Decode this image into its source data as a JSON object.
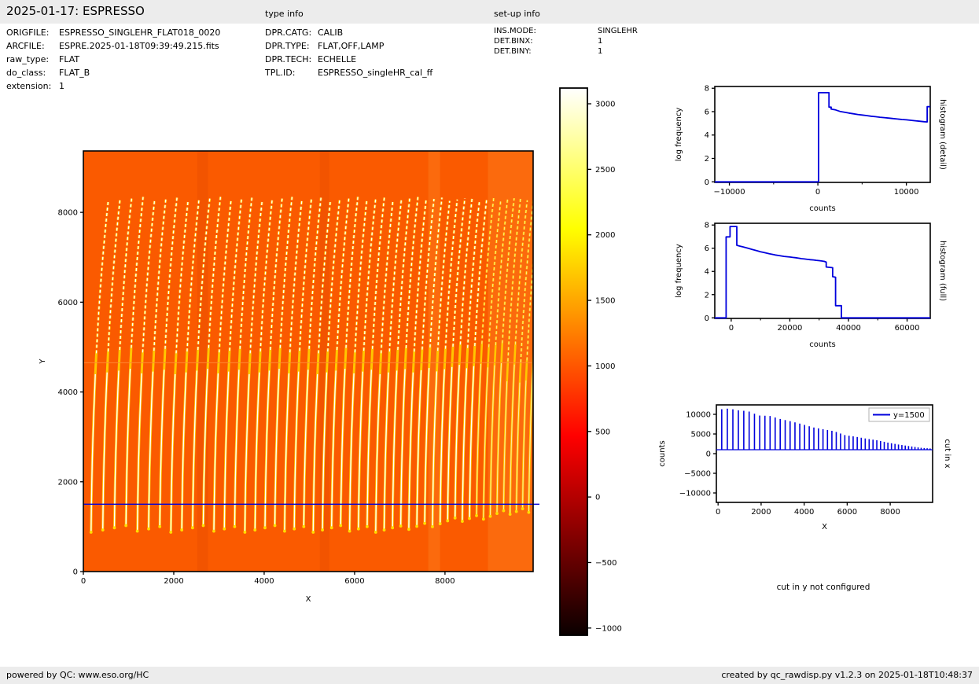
{
  "header": {
    "title": "2025-01-17: ESPRESSO",
    "type_info_label": "type info",
    "setup_info_label": "set-up info"
  },
  "file_info": {
    "rows": [
      {
        "label": "ORIGFILE:",
        "value": "ESPRESSO_SINGLEHR_FLAT018_0020"
      },
      {
        "label": "ARCFILE:",
        "value": "ESPRE.2025-01-18T09:39:49.215.fits"
      },
      {
        "label": "raw_type:",
        "value": "FLAT"
      },
      {
        "label": "do_class:",
        "value": "FLAT_B"
      },
      {
        "label": "extension:",
        "value": "1"
      }
    ]
  },
  "type_info": {
    "rows": [
      {
        "label": "DPR.CATG:",
        "value": "CALIB"
      },
      {
        "label": "DPR.TYPE:",
        "value": "FLAT,OFF,LAMP"
      },
      {
        "label": "DPR.TECH:",
        "value": "ECHELLE"
      },
      {
        "label": "TPL.ID:",
        "value": "ESPRESSO_singleHR_cal_ff"
      }
    ]
  },
  "setup_info": {
    "rows": [
      {
        "label": "INS.MODE:",
        "value": "SINGLEHR"
      },
      {
        "label": "DET.BINX:",
        "value": "1"
      },
      {
        "label": "DET.BINY:",
        "value": "1"
      }
    ]
  },
  "footer": {
    "left": "powered by QC: www.eso.org/HC",
    "right": "created by qc_rawdisp.py v1.2.3 on 2025-01-18T10:48:37"
  },
  "cut_y_note": "cut in y not configured",
  "colors": {
    "line_blue": "#0000dd",
    "image_background": "#fa5a00",
    "stripe_white": "#ffffff",
    "stripe_yellow": "#ffcc00",
    "panel_gray": "#ececec"
  },
  "chart_data": [
    {
      "id": "raw_image",
      "type": "heatmap",
      "xlabel": "X",
      "ylabel": "Y",
      "xlim": [
        0,
        9950
      ],
      "ylim": [
        0,
        9368
      ],
      "x_ticks": [
        0,
        2000,
        4000,
        6000,
        8000
      ],
      "y_ticks": [
        0,
        2000,
        4000,
        6000,
        8000
      ],
      "background_counts": 1000,
      "cut_line_y": 1500,
      "detector_gap_y": 4650,
      "orders": {
        "count": 50,
        "x_start": 170,
        "spacing_start": 260,
        "spacing_step": -2.6,
        "top_shift": 380,
        "y_bottom": 950,
        "y_top": 8300
      },
      "bands": [
        {
          "x0": 2520,
          "x1": 2760,
          "shade": "dark"
        },
        {
          "x0": 5230,
          "x1": 5440,
          "shade": "dark"
        },
        {
          "x0": 7630,
          "x1": 7890,
          "shade": "light"
        },
        {
          "x0": 8950,
          "x1": 9950,
          "shade": "light"
        }
      ]
    },
    {
      "id": "colorbar",
      "type": "colorbar",
      "vmin": -1055,
      "vmax": 3120,
      "ticks": [
        3000,
        2500,
        2000,
        1500,
        1000,
        500,
        0,
        -500,
        -1000
      ],
      "gradient": [
        {
          "v": 3120,
          "color": "#ffffff"
        },
        {
          "v": 2045,
          "color": "#ffff00"
        },
        {
          "v": 465,
          "color": "#ff0000"
        },
        {
          "v": -1055,
          "color": "#0a0000"
        }
      ]
    },
    {
      "id": "hist_detail",
      "type": "line",
      "side_label": "histogram (detail)",
      "xlabel": "counts",
      "ylabel": "log frequency",
      "xlim": [
        -11650,
        12700
      ],
      "ylim": [
        -0.05,
        8.15
      ],
      "x_ticks": [
        -10000,
        0,
        10000
      ],
      "x_minor_ticks": [
        -5000,
        5000
      ],
      "y_ticks": [
        0,
        2,
        4,
        6,
        8
      ],
      "points": [
        [
          -11650,
          0
        ],
        [
          80,
          0
        ],
        [
          80,
          7.62
        ],
        [
          1250,
          7.62
        ],
        [
          1250,
          6.38
        ],
        [
          1500,
          6.38
        ],
        [
          1500,
          6.22
        ],
        [
          2000,
          6.15
        ],
        [
          2500,
          6.02
        ],
        [
          3000,
          5.95
        ],
        [
          3500,
          5.88
        ],
        [
          4000,
          5.82
        ],
        [
          4500,
          5.76
        ],
        [
          5000,
          5.71
        ],
        [
          5500,
          5.66
        ],
        [
          6000,
          5.61
        ],
        [
          6500,
          5.57
        ],
        [
          7000,
          5.52
        ],
        [
          7500,
          5.49
        ],
        [
          8000,
          5.45
        ],
        [
          8500,
          5.41
        ],
        [
          9000,
          5.37
        ],
        [
          9500,
          5.33
        ],
        [
          10000,
          5.3
        ],
        [
          10500,
          5.26
        ],
        [
          11000,
          5.22
        ],
        [
          11500,
          5.18
        ],
        [
          12000,
          5.14
        ],
        [
          12350,
          5.12
        ],
        [
          12350,
          6.42
        ],
        [
          12700,
          6.42
        ]
      ]
    },
    {
      "id": "hist_full",
      "type": "line",
      "side_label": "histogram (full)",
      "xlabel": "counts",
      "ylabel": "log frequency",
      "xlim": [
        -5600,
        67900
      ],
      "ylim": [
        -0.05,
        8.15
      ],
      "x_ticks": [
        0,
        20000,
        40000,
        60000
      ],
      "x_minor_ticks": [
        10000,
        30000,
        50000
      ],
      "y_ticks": [
        0,
        2,
        4,
        6,
        8
      ],
      "points": [
        [
          -5600,
          0
        ],
        [
          -1750,
          0
        ],
        [
          -1750,
          6.98
        ],
        [
          -400,
          6.98
        ],
        [
          -400,
          7.87
        ],
        [
          1900,
          7.87
        ],
        [
          1900,
          6.25
        ],
        [
          2400,
          6.22
        ],
        [
          3000,
          6.18
        ],
        [
          4000,
          6.12
        ],
        [
          5000,
          6.05
        ],
        [
          6000,
          5.98
        ],
        [
          7000,
          5.91
        ],
        [
          8000,
          5.84
        ],
        [
          9000,
          5.77
        ],
        [
          10000,
          5.7
        ],
        [
          11000,
          5.64
        ],
        [
          12000,
          5.58
        ],
        [
          13000,
          5.52
        ],
        [
          14000,
          5.47
        ],
        [
          15000,
          5.42
        ],
        [
          16000,
          5.38
        ],
        [
          17000,
          5.34
        ],
        [
          18000,
          5.3
        ],
        [
          19000,
          5.27
        ],
        [
          20000,
          5.24
        ],
        [
          21000,
          5.21
        ],
        [
          22000,
          5.18
        ],
        [
          23000,
          5.14
        ],
        [
          24000,
          5.1
        ],
        [
          25000,
          5.07
        ],
        [
          26000,
          5.04
        ],
        [
          27000,
          5.01
        ],
        [
          28000,
          4.99
        ],
        [
          29000,
          4.96
        ],
        [
          30000,
          4.93
        ],
        [
          31000,
          4.9
        ],
        [
          31800,
          4.86
        ],
        [
          32400,
          4.8
        ],
        [
          32400,
          4.38
        ],
        [
          34600,
          4.32
        ],
        [
          34600,
          3.55
        ],
        [
          35600,
          3.5
        ],
        [
          35600,
          1.05
        ],
        [
          37600,
          1.05
        ],
        [
          37600,
          0
        ],
        [
          67900,
          0
        ]
      ]
    },
    {
      "id": "cut_x",
      "type": "line",
      "side_label": "cut in x",
      "legend_label": "y=1500",
      "xlabel": "X",
      "ylabel": "counts",
      "xlim": [
        -80,
        9970
      ],
      "ylim": [
        -12400,
        12400
      ],
      "x_ticks": [
        0,
        2000,
        4000,
        6000,
        8000
      ],
      "y_ticks": [
        10000,
        5000,
        0,
        -5000,
        -10000
      ],
      "baseline_counts": 1000,
      "spike_height_envelope": [
        [
          170,
          11300
        ],
        [
          500,
          11480
        ],
        [
          900,
          11050
        ],
        [
          1400,
          10800
        ],
        [
          1900,
          9700
        ],
        [
          2400,
          9600
        ],
        [
          2900,
          8800
        ],
        [
          3400,
          8200
        ],
        [
          3900,
          7500
        ],
        [
          4400,
          6700
        ],
        [
          4900,
          6200
        ],
        [
          5400,
          5700
        ],
        [
          5900,
          4700
        ],
        [
          6400,
          4300
        ],
        [
          6900,
          3800
        ],
        [
          7400,
          3400
        ],
        [
          7900,
          2800
        ],
        [
          8400,
          2300
        ],
        [
          8900,
          1900
        ],
        [
          9400,
          1500
        ],
        [
          9900,
          1300
        ]
      ]
    }
  ]
}
